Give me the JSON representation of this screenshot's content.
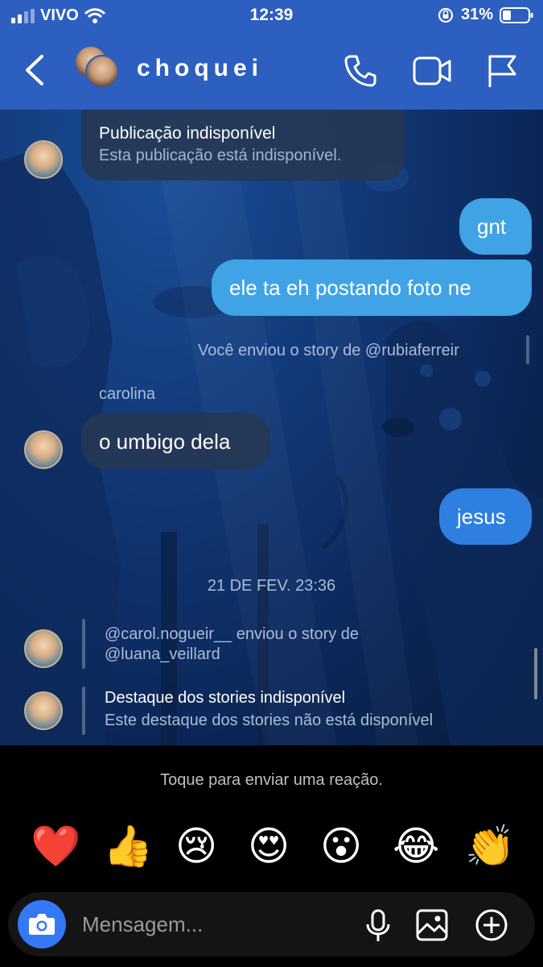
{
  "status_bar": {
    "carrier": "VIVO",
    "time": "12:39",
    "battery": "31%"
  },
  "header": {
    "title": "choquei",
    "icons": [
      "back-chevron-icon",
      "phone-icon",
      "video-camera-icon",
      "flag-icon"
    ]
  },
  "messages": {
    "unavailable_post": {
      "title": "Publicação indisponível",
      "subtitle": "Esta publicação está indisponível."
    },
    "out_1": "gnt",
    "out_2": "ele ta eh postando foto ne",
    "story_sent": "Você enviou o story de @rubiaferreir",
    "sender_name": "carolina",
    "in_1": "o umbigo dela",
    "out_3": "jesus",
    "date_separator": "21 DE FEV. 23:36",
    "story_forward": {
      "line1": "@carol.nogueir__ enviou o story de",
      "line2": "@luana_veillard"
    },
    "highlight_unavailable": {
      "title": "Destaque dos stories indisponível",
      "subtitle": "Este destaque dos stories não está disponível"
    }
  },
  "reactions": {
    "hint": "Toque para enviar uma reação.",
    "emojis": [
      "❤️",
      "👍",
      "😢",
      "😍",
      "😮",
      "😂",
      "👏"
    ]
  },
  "composer": {
    "placeholder": "Mensagem..."
  },
  "colors": {
    "header_blue": "#2c5fbf",
    "bubble_out_light": "#3fa3e6",
    "bubble_out_dark": "#2f7fe0",
    "camera_button": "#3478f6"
  }
}
